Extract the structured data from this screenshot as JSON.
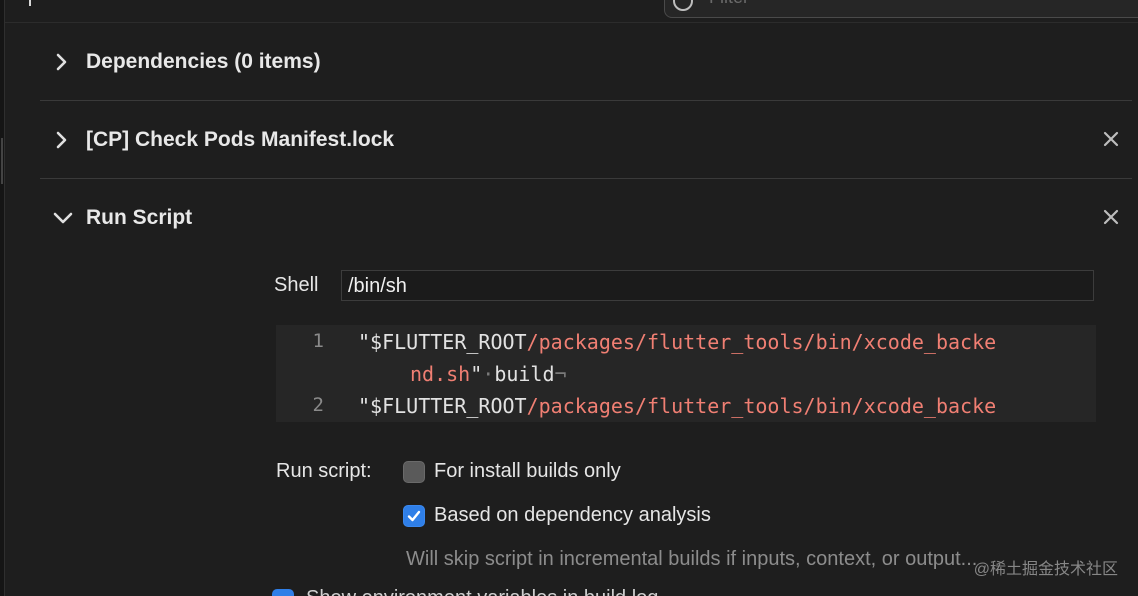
{
  "filter": {
    "placeholder": "Filter"
  },
  "sections": {
    "dependencies": {
      "title": "Dependencies (0 items)"
    },
    "check_pods": {
      "title": "[CP] Check Pods Manifest.lock"
    },
    "run_script": {
      "title": "Run Script"
    }
  },
  "run_script": {
    "shell_label": "Shell",
    "shell_value": "/bin/sh",
    "code": {
      "lines": [
        {
          "number": "1",
          "quote_open": "\"$FLUTTER_ROOT",
          "path": "/packages/flutter_tools/bin/xcode_backe",
          "cont_path": "nd.sh",
          "cont_rest": "\"",
          "space_mark": "·",
          "arg": "build",
          "eol": "¬"
        },
        {
          "number": "2",
          "quote_open": "\"$FLUTTER_ROOT",
          "path": "/packages/flutter_tools/bin/xcode_backe"
        }
      ]
    },
    "options_label": "Run script:",
    "options": [
      {
        "label": "For install builds only",
        "checked": false
      },
      {
        "label": "Based on dependency analysis",
        "checked": true
      }
    ],
    "hint": "Will skip script in incremental builds if inputs, context, or output...",
    "partial_bottom_text": "Show environment variables in build log"
  },
  "watermark": "@稀土掘金技术社区",
  "colors": {
    "background": "#1e1e1e",
    "accent_blue": "#2f7fe8",
    "string_path": "#f07f73"
  }
}
